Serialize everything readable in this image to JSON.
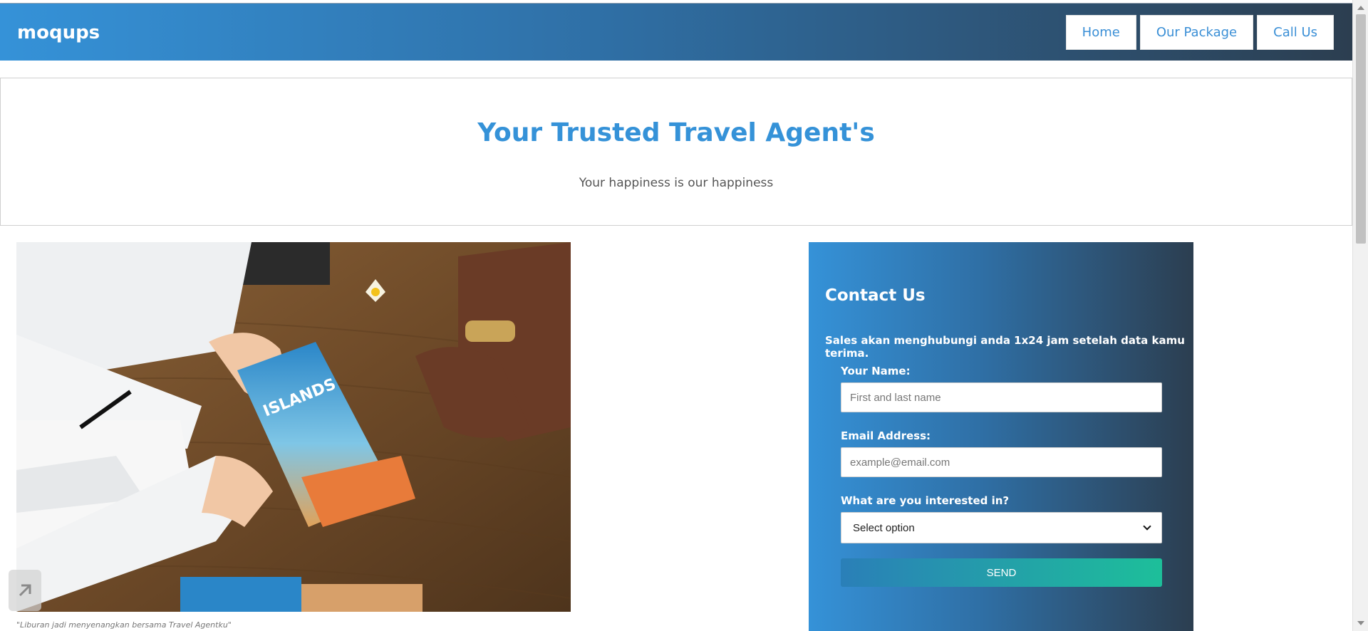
{
  "header": {
    "brand": "moqups",
    "nav": [
      "Home",
      "Our Package",
      "Call Us"
    ]
  },
  "hero": {
    "title": "Your Trusted Travel Agent's",
    "subtitle": "Your happiness is our happiness"
  },
  "photo": {
    "caption": "\"Liburan jadi menyenangkan bersama Travel Agentku\"",
    "brochure_text": "ISLANDS"
  },
  "contact": {
    "title": "Contact Us",
    "note": "Sales akan menghubungi anda 1x24 jam setelah data kamu terima.",
    "name_label": "Your Name:",
    "name_placeholder": "First and last name",
    "email_label": "Email Address:",
    "email_placeholder": "example@email.com",
    "interest_label": "What are you interested in?",
    "interest_selected": "Select option",
    "send_label": "SEND"
  },
  "colors": {
    "brand_blue": "#3592d8",
    "gradient_dark": "#2c3e50",
    "send_teal": "#1dbf9a"
  }
}
